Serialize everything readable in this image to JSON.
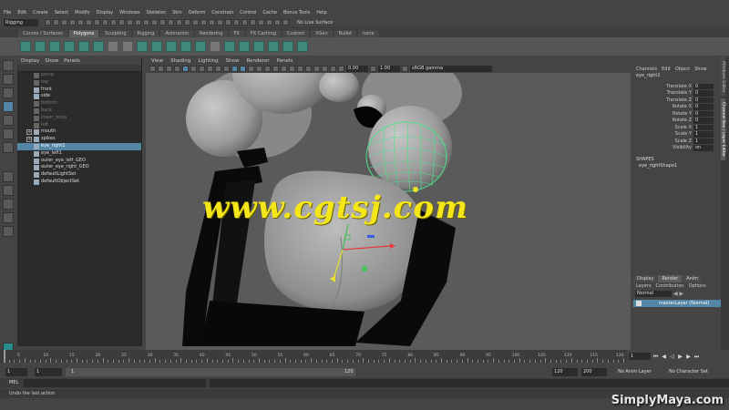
{
  "menubar": [
    "File",
    "Edit",
    "Create",
    "Select",
    "Modify",
    "Display",
    "Windows",
    "Skeleton",
    "Skin",
    "Deform",
    "Constrain",
    "Control",
    "Cache",
    "Bonus Tools",
    "Help"
  ],
  "status": {
    "mode": "Rigging",
    "live_surface": "No Live Surface"
  },
  "shelf_tabs": [
    "Curves / Surfaces",
    "Polygons",
    "Sculpting",
    "Rigging",
    "Animation",
    "Rendering",
    "FX",
    "FX Caching",
    "Custom",
    "XGen",
    "Bullet",
    "none"
  ],
  "shelf_active": "Polygons",
  "outliner": {
    "menu": [
      "Display",
      "Show",
      "Panels"
    ],
    "items": [
      {
        "label": "persp",
        "dim": true
      },
      {
        "label": "top",
        "dim": true
      },
      {
        "label": "front",
        "dim": false
      },
      {
        "label": "side",
        "dim": false
      },
      {
        "label": "bottom",
        "dim": true
      },
      {
        "label": "back",
        "dim": true
      },
      {
        "label": "lower_body",
        "dim": true
      },
      {
        "label": "left",
        "dim": true
      },
      {
        "label": "mouth",
        "dim": false,
        "exp": "+"
      },
      {
        "label": "spikes",
        "dim": false,
        "exp": "+"
      },
      {
        "label": "eye_right1",
        "dim": false,
        "sel": true
      },
      {
        "label": "eye_left1",
        "dim": false
      },
      {
        "label": "outer_eye_left_GEO",
        "dim": false
      },
      {
        "label": "outer_eye_right_GEO",
        "dim": false
      },
      {
        "label": "defaultLightSet",
        "dim": false
      },
      {
        "label": "defaultObjectSet",
        "dim": false
      }
    ]
  },
  "viewport": {
    "menu": [
      "View",
      "Shading",
      "Lighting",
      "Show",
      "Renderer",
      "Panels"
    ],
    "field1": "0.00",
    "field2": "1.00",
    "color_space": "sRGB gamma"
  },
  "channel_box": {
    "menu": [
      "Channels",
      "Edit",
      "Object",
      "Show"
    ],
    "object": "eye_right1",
    "attrs": [
      {
        "label": "Translate X",
        "value": "0"
      },
      {
        "label": "Translate Y",
        "value": "0"
      },
      {
        "label": "Translate Z",
        "value": "0"
      },
      {
        "label": "Rotate X",
        "value": "0"
      },
      {
        "label": "Rotate Y",
        "value": "0"
      },
      {
        "label": "Rotate Z",
        "value": "0"
      },
      {
        "label": "Scale X",
        "value": "1"
      },
      {
        "label": "Scale Y",
        "value": "1"
      },
      {
        "label": "Scale Z",
        "value": "1"
      },
      {
        "label": "Visibility",
        "value": "on"
      }
    ],
    "shapes_header": "SHAPES",
    "shape": "eye_rightShape1"
  },
  "layer_editor": {
    "tabs": [
      "Display",
      "Render",
      "Anim"
    ],
    "active_tab": "Render",
    "menu": [
      "Layers",
      "Contribution",
      "Options"
    ],
    "blend": "Normal",
    "layer": "masterLayer (Normal)"
  },
  "side_tabs": [
    "Attribute Editor",
    "Channel Box / Layer Editor"
  ],
  "timeline": {
    "ticks": [
      "5",
      "10",
      "15",
      "20",
      "25",
      "30",
      "35",
      "40",
      "45",
      "50",
      "55",
      "60",
      "65",
      "70",
      "75",
      "80",
      "85",
      "90",
      "95",
      "100",
      "105",
      "110",
      "115",
      "120"
    ],
    "current": "1"
  },
  "range": {
    "start": "1",
    "inner_start": "1",
    "inner_value": "1",
    "inner_end": "120",
    "end": "120",
    "max": "200",
    "anim_layer": "No Anim Layer",
    "char_set": "No Character Set"
  },
  "cmd": {
    "label": "MEL"
  },
  "help": {
    "text": "Undo the last action"
  },
  "watermark": "www.cgtsj.com",
  "logo": "SimplyMaya.com"
}
